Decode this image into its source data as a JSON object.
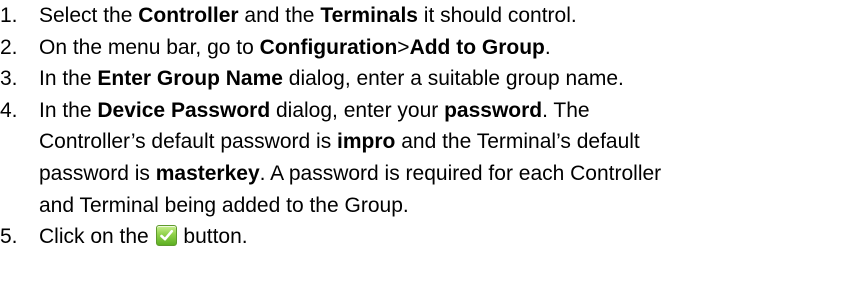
{
  "steps": [
    {
      "number": "1.",
      "parts": [
        {
          "t": "Select the "
        },
        {
          "t": "Controller",
          "b": true
        },
        {
          "t": " and the "
        },
        {
          "t": "Terminals",
          "b": true
        },
        {
          "t": " it should control."
        }
      ]
    },
    {
      "number": "2.",
      "parts": [
        {
          "t": "On the menu bar, go to "
        },
        {
          "t": "Configuration",
          "b": true
        },
        {
          "t": ">"
        },
        {
          "t": "Add to Group",
          "b": true
        },
        {
          "t": "."
        }
      ]
    },
    {
      "number": "3.",
      "parts": [
        {
          "t": "In the "
        },
        {
          "t": "Enter Group Name",
          "b": true
        },
        {
          "t": " dialog, enter a suitable group name."
        }
      ]
    },
    {
      "number": "4.",
      "lines": [
        [
          {
            "t": "In the "
          },
          {
            "t": "Device Password",
            "b": true
          },
          {
            "t": " dialog, enter your "
          },
          {
            "t": "password",
            "b": true
          },
          {
            "t": ".  The"
          }
        ],
        [
          {
            "t": "Controller’s default password is "
          },
          {
            "t": "impro",
            "b": true
          },
          {
            "t": " and the Terminal’s default"
          }
        ],
        [
          {
            "t": "password is "
          },
          {
            "t": "masterkey",
            "b": true
          },
          {
            "t": ".  A password is required for each Controller"
          }
        ],
        [
          {
            "t": "and Terminal being added to the Group."
          }
        ]
      ]
    },
    {
      "number": "5.",
      "parts": [
        {
          "t": "Click on the "
        },
        {
          "icon": "green-checkmark-icon"
        },
        {
          "t": " button."
        }
      ]
    }
  ],
  "colors": {
    "text": "#000000",
    "background": "#ffffff",
    "icon_green": "#6cbf2a",
    "icon_check": "#ffffff"
  }
}
